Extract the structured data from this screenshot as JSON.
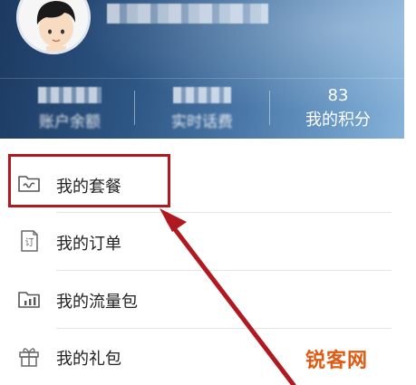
{
  "header": {
    "user_name": "",
    "stats": [
      {
        "value": "",
        "label": "账户余额"
      },
      {
        "value": "",
        "label": "实时话费"
      },
      {
        "value": "83",
        "label": "我的积分"
      }
    ]
  },
  "menu": {
    "items": [
      {
        "label": "我的套餐",
        "icon": "package-folder-icon"
      },
      {
        "label": "我的订单",
        "icon": "order-document-icon"
      },
      {
        "label": "我的流量包",
        "icon": "data-chart-icon"
      },
      {
        "label": "我的礼包",
        "icon": "gift-icon"
      }
    ]
  },
  "annotation": {
    "highlight_color": "#b0191f",
    "arrow_color": "#b0191f"
  },
  "watermark": {
    "text": "锐客网",
    "color": "#e25a12"
  },
  "colors": {
    "header_dark": "#1c3a62",
    "header_light": "#87b3da",
    "menu_text": "#222222",
    "separator": "#e4e4e4"
  }
}
